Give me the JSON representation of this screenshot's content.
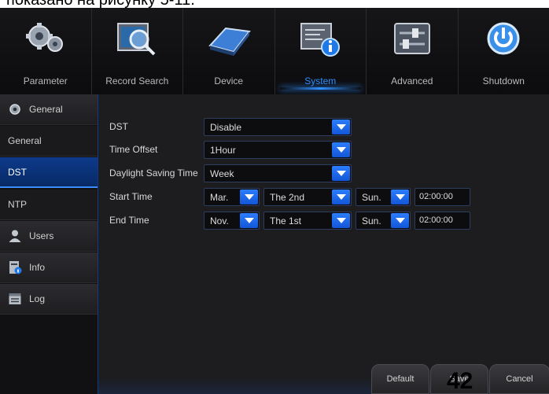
{
  "document": {
    "caption": "показано на рисунку 5-11.",
    "page_number": "42"
  },
  "top_menu": [
    {
      "label": "Parameter",
      "icon": "gears-icon"
    },
    {
      "label": "Record Search",
      "icon": "film-search-icon"
    },
    {
      "label": "Device",
      "icon": "hard-drive-icon"
    },
    {
      "label": "System",
      "icon": "system-info-icon",
      "active": true
    },
    {
      "label": "Advanced",
      "icon": "sliders-icon"
    },
    {
      "label": "Shutdown",
      "icon": "power-icon"
    }
  ],
  "sidebar": {
    "general_group": "General",
    "general": "General",
    "dst": "DST",
    "ntp": "NTP",
    "users": "Users",
    "info": "Info",
    "log": "Log"
  },
  "form": {
    "dst": {
      "label": "DST",
      "value": "Disable"
    },
    "time_offset": {
      "label": "Time Offset",
      "value": "1Hour"
    },
    "daylight_saving_time": {
      "label": "Daylight Saving Time",
      "value": "Week"
    },
    "start_time": {
      "label": "Start Time",
      "month": "Mar.",
      "week": "The 2nd",
      "day": "Sun.",
      "time": "02:00:00"
    },
    "end_time": {
      "label": "End Time",
      "month": "Nov.",
      "week": "The 1st",
      "day": "Sun.",
      "time": "02:00:00"
    }
  },
  "buttons": {
    "default": "Default",
    "save": "Save",
    "cancel": "Cancel"
  },
  "colors": {
    "accent": "#2f8fff",
    "active_nav": "#0d3a8a",
    "background": "#1a1a1c"
  }
}
